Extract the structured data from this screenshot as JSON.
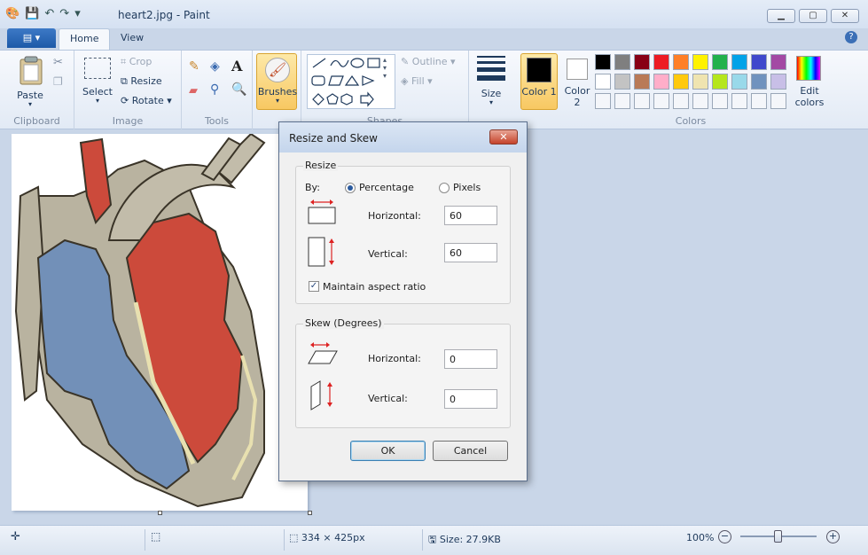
{
  "window": {
    "title": "heart2.jpg - Paint"
  },
  "tabs": {
    "file": "",
    "home": "Home",
    "view": "View"
  },
  "ribbon": {
    "clipboard": {
      "paste": "Paste",
      "label": "Clipboard"
    },
    "image": {
      "select": "Select",
      "crop": "Crop",
      "resize": "Resize",
      "rotate": "Rotate",
      "label": "Image"
    },
    "tools": {
      "label": "Tools"
    },
    "brushes": {
      "label": "Brushes"
    },
    "shapes": {
      "outline": "Outline",
      "fill": "Fill",
      "label": "Shapes"
    },
    "size": {
      "label": "Size"
    },
    "colors": {
      "color1": "Color 1",
      "color2": "Color 2",
      "edit": "Edit colors",
      "label": "Colors",
      "palette_row1": [
        "#000000",
        "#7f7f7f",
        "#880015",
        "#ed1c24",
        "#ff7f27",
        "#fff200",
        "#22b14c",
        "#00a2e8",
        "#3f48cc",
        "#a349a4"
      ],
      "palette_row2": [
        "#ffffff",
        "#c3c3c3",
        "#b97a57",
        "#ffaec9",
        "#ffc90e",
        "#efe4b0",
        "#b5e61d",
        "#99d9ea",
        "#7092be",
        "#c8bfe7"
      ]
    }
  },
  "dialog": {
    "title": "Resize and Skew",
    "close": "✕",
    "resize": {
      "legend": "Resize",
      "by": "By:",
      "percentage": "Percentage",
      "pixels": "Pixels",
      "horizontal_label": "Horizontal:",
      "horizontal_value": "60",
      "vertical_label": "Vertical:",
      "vertical_value": "60",
      "maintain": "Maintain aspect ratio"
    },
    "skew": {
      "legend": "Skew (Degrees)",
      "horizontal_label": "Horizontal:",
      "horizontal_value": "0",
      "vertical_label": "Vertical:",
      "vertical_value": "0"
    },
    "ok": "OK",
    "cancel": "Cancel"
  },
  "status": {
    "dimensions": "334 × 425px",
    "size": "Size: 27.9KB",
    "zoom": "100%"
  }
}
